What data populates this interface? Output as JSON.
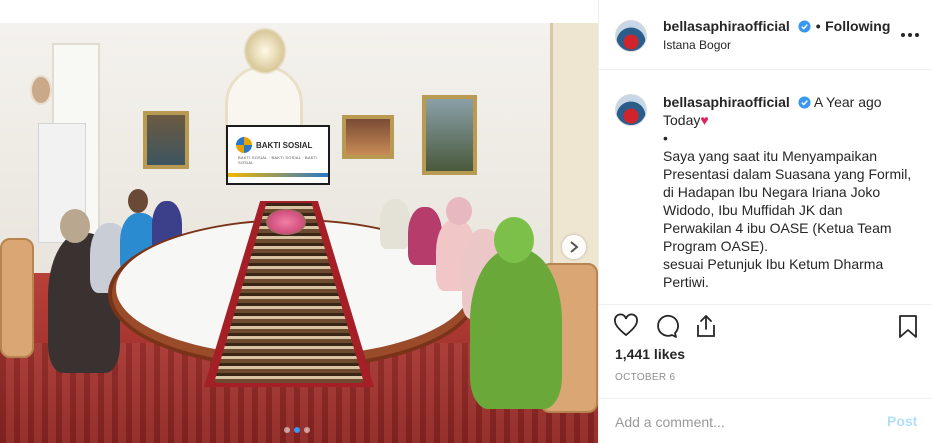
{
  "post": {
    "username": "bellasaphiraofficial",
    "follow_status": "Following",
    "separator": "•",
    "location": "Istana Bogor"
  },
  "photo": {
    "screen_title": "BAKTI SOSIAL",
    "screen_subtitle": "BAKTI SOSIAL · BAKTI SOSIAL · BAKTI SOSIAL",
    "carousel_count": 3,
    "carousel_active_index": 1
  },
  "caption": {
    "username": "bellasaphiraofficial",
    "time_ago": "A Year ago",
    "lines": [
      "Today",
      "•",
      "Saya yang saat itu Menyampaikan",
      "Presentasi dalam Suasana yang Formil,",
      "di Hadapan Ibu Negara Iriana Joko",
      "Widodo, Ibu Muffidah JK dan",
      "Perwakilan 4 ibu OASE (Ketua Team",
      "Program OASE).",
      "sesuai Petunjuk Ibu Ketum Dharma",
      "Pertiwi."
    ],
    "heart_emoji": "♥"
  },
  "stats": {
    "likes": "1,441 likes",
    "date": "OCTOBER 6"
  },
  "comment_box": {
    "placeholder": "Add a comment...",
    "post_label": "Post"
  },
  "colors": {
    "verified_blue": "#3897f0",
    "post_disabled": "#b2dffc",
    "heart_red": "#e0245e"
  },
  "icons": [
    "verified-icon",
    "more-options-icon",
    "like-heart-icon",
    "comment-icon",
    "share-icon",
    "bookmark-icon",
    "carousel-next-icon"
  ]
}
